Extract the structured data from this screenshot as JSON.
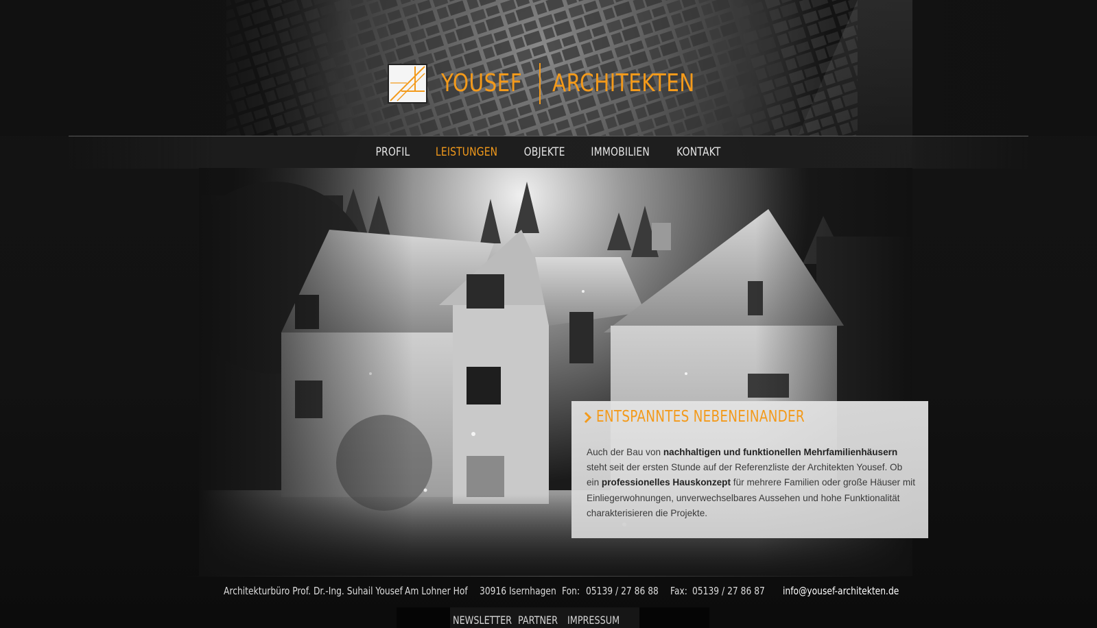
{
  "brand": {
    "name_left": "YOUSEF",
    "name_right": "ARCHITEKTEN",
    "logo_icon": "architect-square-logo",
    "accent_color": "#f39a1b"
  },
  "nav": {
    "items": [
      {
        "label": "PROFIL",
        "active": false
      },
      {
        "label": "LEISTUNGEN",
        "active": true
      },
      {
        "label": "OBJEKTE",
        "active": false
      },
      {
        "label": "IMMOBILIEN",
        "active": false
      },
      {
        "label": "KONTAKT",
        "active": false
      }
    ]
  },
  "hero": {
    "image": "black-and-white photo of snow-covered house with trees"
  },
  "panel": {
    "arrow_icon": "chevron-right-icon",
    "title": "ENTSPANNTES NEBENEINANDER",
    "text_1": "Auch der Bau von ",
    "text_bold_1": "nachhaltigen und funktionellen Mehrfamilienhäusern",
    "text_2": " steht seit der ersten Stunde auf der Referenzliste der Architekten Yousef. Ob ein ",
    "text_bold_2": "professionelles Hauskonzept",
    "text_3": " für mehrere Familien oder große Häuser mit Einliegerwohnungen, unverwechselbares Aussehen und hohe Funktionalität charakterisieren die Projekte."
  },
  "footer": {
    "company": "Architekturbüro Prof. Dr.-Ing. Suhail Yousef",
    "street": "Am Lohner Hof",
    "city": "30916 Isernhagen",
    "phone_label": "Fon:",
    "phone": "05139 / 27 86 88",
    "fax_label": "Fax:",
    "fax": "05139 / 27 86 87",
    "email": "info@yousef-architekten.de",
    "links": [
      "NEWSLETTER",
      "PARTNER",
      "IMPRESSUM"
    ]
  }
}
